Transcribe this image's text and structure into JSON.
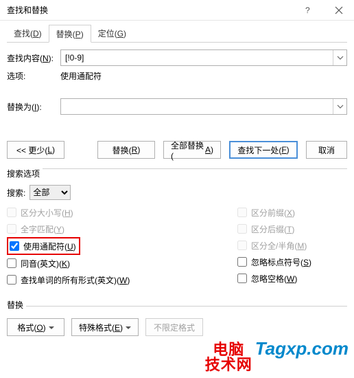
{
  "window": {
    "title": "查找和替换"
  },
  "tabs": {
    "find": "查找(",
    "find_k": "D",
    "find_end": ")",
    "replace": "替换(",
    "replace_k": "P",
    "replace_end": ")",
    "goto": "定位(",
    "goto_k": "G",
    "goto_end": ")"
  },
  "labels": {
    "find_what": "查找内容(",
    "find_what_k": "N",
    "find_what_end": "):",
    "replace_with": "替换为(",
    "replace_with_k": "I",
    "replace_with_end": "):",
    "options": "选项:",
    "options_value": "使用通配符"
  },
  "fields": {
    "find_value": "[!0-9]",
    "replace_value": ""
  },
  "buttons": {
    "less_pre": "<< 更少(",
    "less_k": "L",
    "less_end": ")",
    "replace": "替换(",
    "replace_k_btn": "R",
    "replace_end": ")",
    "replace_all": "全部替换(",
    "replace_all_k": "A",
    "replace_all_end": ")",
    "find_next": "查找下一处(",
    "find_next_k": "F",
    "find_next_end": ")",
    "cancel": "取消"
  },
  "search_options": {
    "legend": "搜索选项",
    "direction_label": "搜索:",
    "direction_value": "全部",
    "match_case": "区分大小写(",
    "match_case_k": "H",
    "match_case_end": ")",
    "whole_word": "全字匹配(",
    "whole_word_k": "Y",
    "whole_word_end": ")",
    "wildcards": "使用通配符(",
    "wildcards_k": "U",
    "wildcards_end": ")",
    "sounds_like": "同音(英文)(",
    "sounds_like_k": "K",
    "sounds_like_end": ")",
    "all_forms": "查找单词的所有形式(英文)(",
    "all_forms_k": "W",
    "all_forms_end": ")",
    "prefix": "区分前缀(",
    "prefix_k": "X",
    "prefix_end": ")",
    "suffix": "区分后缀(",
    "suffix_k": "T",
    "suffix_end": ")",
    "fullhalf": "区分全/半角(",
    "fullhalf_k": "M",
    "fullhalf_end": ")",
    "punct": "忽略标点符号(",
    "punct_k": "S",
    "punct_end": ")",
    "space": "忽略空格(",
    "space_k": "W",
    "space_end": ")"
  },
  "replace_section": {
    "legend": "替换",
    "format": "格式(",
    "format_k": "O",
    "format_end": ")",
    "special": "特殊格式(",
    "special_k": "E",
    "special_end": ")",
    "noformat": "不限定格式"
  },
  "watermark": {
    "line1": "电脑",
    "line2": "技术网",
    "domain": "Tagxp.com"
  }
}
